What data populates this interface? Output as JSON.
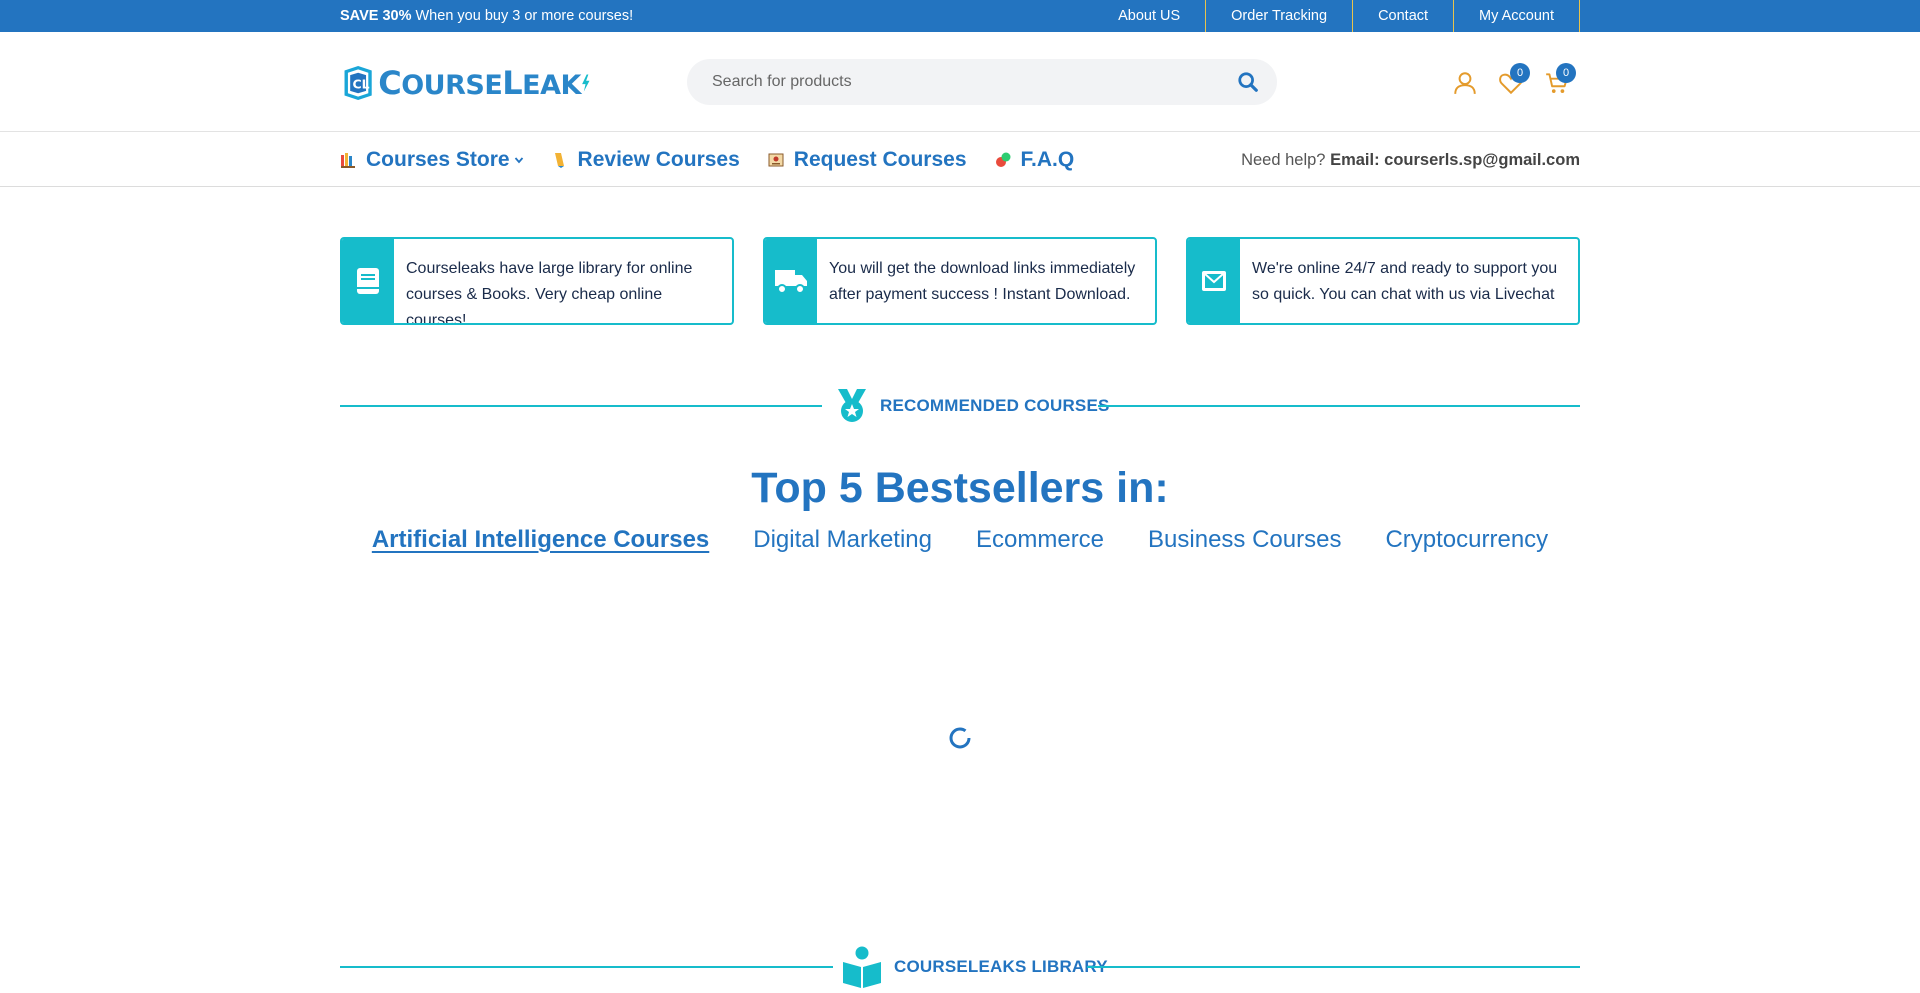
{
  "topbar": {
    "promo_bold": "SAVE 30%",
    "promo_text": "When you buy 3 or more courses!",
    "links": [
      "About US",
      "Order Tracking",
      "Contact",
      "My Account"
    ]
  },
  "header": {
    "logo_text_a": "C",
    "logo_text_b": "OURSE",
    "logo_text_c": "L",
    "logo_text_d": "EAK",
    "search_placeholder": "Search for products",
    "wishlist_count": "0",
    "cart_count": "0"
  },
  "nav": {
    "items": [
      "Courses Store",
      "Review Courses",
      "Request Courses",
      "F.A.Q"
    ],
    "help_label": "Need help?",
    "help_email": "Email: courserls.sp@gmail.com"
  },
  "features": [
    {
      "text": "Courseleaks have large library for online courses & Books. Very cheap online courses!",
      "icon": "book-icon"
    },
    {
      "text": "You will get the download links immediately after payment success ! Instant Download.",
      "icon": "truck-icon"
    },
    {
      "text": "We're online 24/7 and ready to support you so quick. You can chat with us via Livechat",
      "icon": "envelope-icon"
    }
  ],
  "recommended": {
    "label": "RECOMMENDED COURSES",
    "title": "Top 5 Bestsellers in:",
    "tabs": [
      "Artificial Intelligence Courses",
      "Digital Marketing",
      "Ecommerce",
      "Business Courses",
      "Cryptocurrency"
    ],
    "active_tab": 0
  },
  "library": {
    "label": "COURSELEAKS LIBRARY"
  },
  "colors": {
    "brand": "#2374c0",
    "accent": "#16bccb",
    "topbar_divider": "#e7c34c",
    "icon_orange": "#e49b2c"
  }
}
